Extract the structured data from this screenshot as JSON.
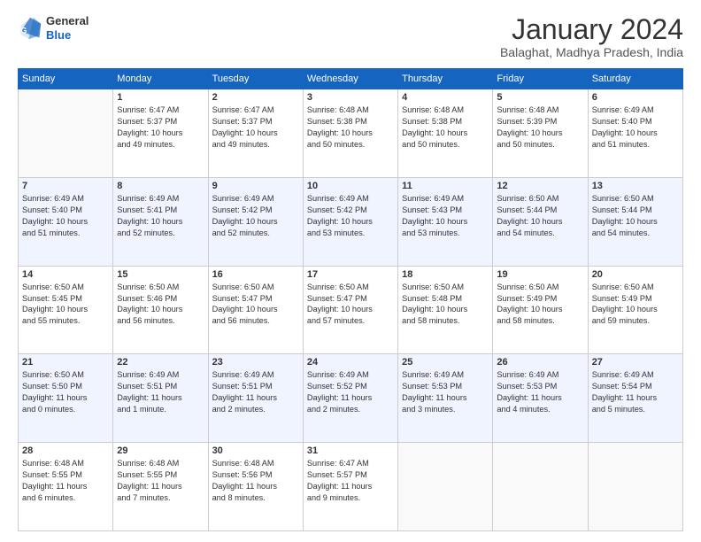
{
  "header": {
    "logo": {
      "line1": "General",
      "line2": "Blue"
    },
    "title": "January 2024",
    "location": "Balaghat, Madhya Pradesh, India"
  },
  "weekdays": [
    "Sunday",
    "Monday",
    "Tuesday",
    "Wednesday",
    "Thursday",
    "Friday",
    "Saturday"
  ],
  "weeks": [
    {
      "alt": false,
      "days": [
        {
          "num": "",
          "info": ""
        },
        {
          "num": "1",
          "info": "Sunrise: 6:47 AM\nSunset: 5:37 PM\nDaylight: 10 hours\nand 49 minutes."
        },
        {
          "num": "2",
          "info": "Sunrise: 6:47 AM\nSunset: 5:37 PM\nDaylight: 10 hours\nand 49 minutes."
        },
        {
          "num": "3",
          "info": "Sunrise: 6:48 AM\nSunset: 5:38 PM\nDaylight: 10 hours\nand 50 minutes."
        },
        {
          "num": "4",
          "info": "Sunrise: 6:48 AM\nSunset: 5:38 PM\nDaylight: 10 hours\nand 50 minutes."
        },
        {
          "num": "5",
          "info": "Sunrise: 6:48 AM\nSunset: 5:39 PM\nDaylight: 10 hours\nand 50 minutes."
        },
        {
          "num": "6",
          "info": "Sunrise: 6:49 AM\nSunset: 5:40 PM\nDaylight: 10 hours\nand 51 minutes."
        }
      ]
    },
    {
      "alt": true,
      "days": [
        {
          "num": "7",
          "info": "Sunrise: 6:49 AM\nSunset: 5:40 PM\nDaylight: 10 hours\nand 51 minutes."
        },
        {
          "num": "8",
          "info": "Sunrise: 6:49 AM\nSunset: 5:41 PM\nDaylight: 10 hours\nand 52 minutes."
        },
        {
          "num": "9",
          "info": "Sunrise: 6:49 AM\nSunset: 5:42 PM\nDaylight: 10 hours\nand 52 minutes."
        },
        {
          "num": "10",
          "info": "Sunrise: 6:49 AM\nSunset: 5:42 PM\nDaylight: 10 hours\nand 53 minutes."
        },
        {
          "num": "11",
          "info": "Sunrise: 6:49 AM\nSunset: 5:43 PM\nDaylight: 10 hours\nand 53 minutes."
        },
        {
          "num": "12",
          "info": "Sunrise: 6:50 AM\nSunset: 5:44 PM\nDaylight: 10 hours\nand 54 minutes."
        },
        {
          "num": "13",
          "info": "Sunrise: 6:50 AM\nSunset: 5:44 PM\nDaylight: 10 hours\nand 54 minutes."
        }
      ]
    },
    {
      "alt": false,
      "days": [
        {
          "num": "14",
          "info": "Sunrise: 6:50 AM\nSunset: 5:45 PM\nDaylight: 10 hours\nand 55 minutes."
        },
        {
          "num": "15",
          "info": "Sunrise: 6:50 AM\nSunset: 5:46 PM\nDaylight: 10 hours\nand 56 minutes."
        },
        {
          "num": "16",
          "info": "Sunrise: 6:50 AM\nSunset: 5:47 PM\nDaylight: 10 hours\nand 56 minutes."
        },
        {
          "num": "17",
          "info": "Sunrise: 6:50 AM\nSunset: 5:47 PM\nDaylight: 10 hours\nand 57 minutes."
        },
        {
          "num": "18",
          "info": "Sunrise: 6:50 AM\nSunset: 5:48 PM\nDaylight: 10 hours\nand 58 minutes."
        },
        {
          "num": "19",
          "info": "Sunrise: 6:50 AM\nSunset: 5:49 PM\nDaylight: 10 hours\nand 58 minutes."
        },
        {
          "num": "20",
          "info": "Sunrise: 6:50 AM\nSunset: 5:49 PM\nDaylight: 10 hours\nand 59 minutes."
        }
      ]
    },
    {
      "alt": true,
      "days": [
        {
          "num": "21",
          "info": "Sunrise: 6:50 AM\nSunset: 5:50 PM\nDaylight: 11 hours\nand 0 minutes."
        },
        {
          "num": "22",
          "info": "Sunrise: 6:49 AM\nSunset: 5:51 PM\nDaylight: 11 hours\nand 1 minute."
        },
        {
          "num": "23",
          "info": "Sunrise: 6:49 AM\nSunset: 5:51 PM\nDaylight: 11 hours\nand 2 minutes."
        },
        {
          "num": "24",
          "info": "Sunrise: 6:49 AM\nSunset: 5:52 PM\nDaylight: 11 hours\nand 2 minutes."
        },
        {
          "num": "25",
          "info": "Sunrise: 6:49 AM\nSunset: 5:53 PM\nDaylight: 11 hours\nand 3 minutes."
        },
        {
          "num": "26",
          "info": "Sunrise: 6:49 AM\nSunset: 5:53 PM\nDaylight: 11 hours\nand 4 minutes."
        },
        {
          "num": "27",
          "info": "Sunrise: 6:49 AM\nSunset: 5:54 PM\nDaylight: 11 hours\nand 5 minutes."
        }
      ]
    },
    {
      "alt": false,
      "days": [
        {
          "num": "28",
          "info": "Sunrise: 6:48 AM\nSunset: 5:55 PM\nDaylight: 11 hours\nand 6 minutes."
        },
        {
          "num": "29",
          "info": "Sunrise: 6:48 AM\nSunset: 5:55 PM\nDaylight: 11 hours\nand 7 minutes."
        },
        {
          "num": "30",
          "info": "Sunrise: 6:48 AM\nSunset: 5:56 PM\nDaylight: 11 hours\nand 8 minutes."
        },
        {
          "num": "31",
          "info": "Sunrise: 6:47 AM\nSunset: 5:57 PM\nDaylight: 11 hours\nand 9 minutes."
        },
        {
          "num": "",
          "info": ""
        },
        {
          "num": "",
          "info": ""
        },
        {
          "num": "",
          "info": ""
        }
      ]
    }
  ]
}
